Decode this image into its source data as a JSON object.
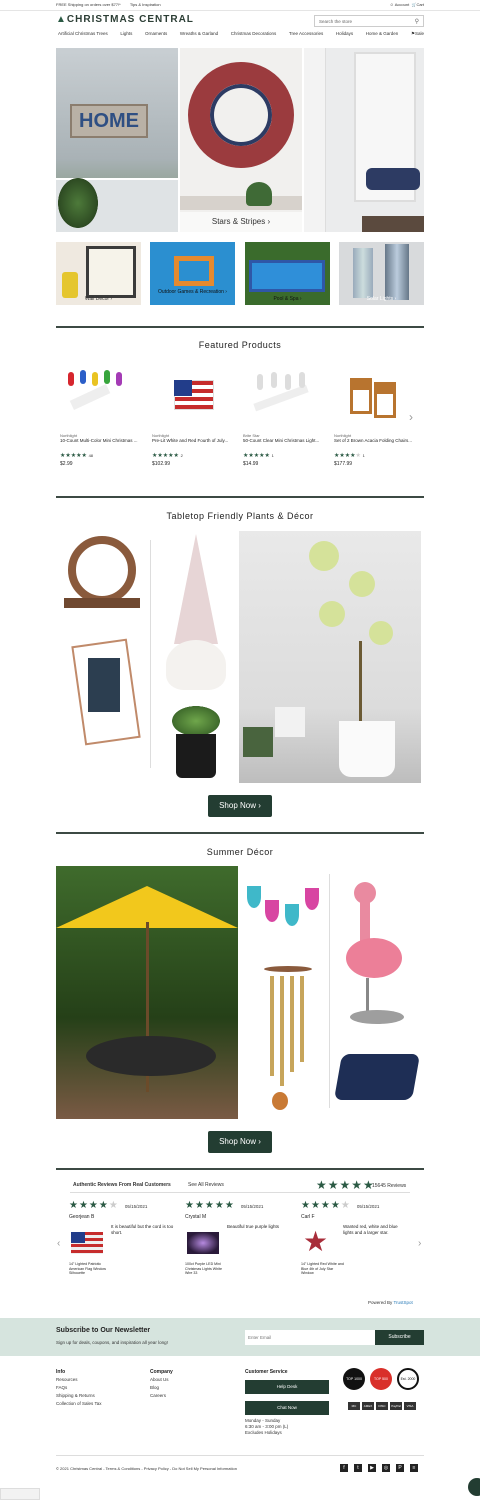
{
  "topbar": {
    "shipping": "FREE Shipping on orders over $77!*",
    "tips": "Tips & Inspiration",
    "account": "Account",
    "cart": "Cart"
  },
  "header": {
    "logo": "CHRISTMAS CENTRAL",
    "search_placeholder": "Search the store"
  },
  "nav": [
    "Artificial Christmas Trees",
    "Lights",
    "Ornaments",
    "Wreaths & Garland",
    "Christmas Decorations",
    "Tree Accessories",
    "Holidays",
    "Home & Garden",
    "Sale"
  ],
  "hero": {
    "caption": "Stars & Stripes ›"
  },
  "panels": [
    {
      "label": "Wall Decor ›"
    },
    {
      "label": "Outdoor Games & Recreation ›"
    },
    {
      "label": "Pool & Spa ›"
    },
    {
      "label": "Solar Lights ›"
    }
  ],
  "featured": {
    "title": "Featured Products",
    "products": [
      {
        "brand": "Northlight",
        "name": "10-Count Multi-Color Mini Christmas ...",
        "count": "48",
        "price": "$2.99",
        "rating": 5
      },
      {
        "brand": "Northlight",
        "name": "Pre-Lit White and Red Fourth of July...",
        "count": "2",
        "price": "$102.99",
        "rating": 5
      },
      {
        "brand": "Brite Star",
        "name": "50-Count Clear Mini Christmas Light...",
        "count": "1",
        "price": "$14.99",
        "rating": 5
      },
      {
        "brand": "Northlight",
        "name": "Set of 2 Brown Acacia Folding Chairs...",
        "count": "1",
        "price": "$177.99",
        "rating": 4
      }
    ]
  },
  "tabletop": {
    "title": "Tabletop Friendly Plants & Décor",
    "cta": "Shop Now ›"
  },
  "summer": {
    "title": "Summer Décor",
    "cta": "Shop Now ›"
  },
  "reviews": {
    "heading": "Authentic Reviews From Real Customers",
    "see_all": "See All Reviews",
    "total": "15645 Reviews",
    "powered": "Powered By",
    "brand": "TrustSpot",
    "items": [
      {
        "name": "Georjean B",
        "date": "05/15/2021",
        "text": "It is beautiful but the cord is too short.",
        "product": "14\" Lighted Patriotic American Flag Window Silhouette",
        "rating": 4
      },
      {
        "name": "Crystal M",
        "date": "05/15/2021",
        "text": "Beautiful true purple lights",
        "product": "100ct Purple LED Mini Christmas Lights White Wire 33",
        "rating": 5
      },
      {
        "name": "Carl F",
        "date": "05/15/2021",
        "text": "Wanted red, white and blue lights and a larger star.",
        "product": "14\" Lighted Red White and Blue 4th of July Star Window",
        "rating": 4
      }
    ]
  },
  "newsletter": {
    "title": "Subscribe to Our Newsletter",
    "subtitle": "Sign up for deals, coupons, and inspiration all year long!",
    "placeholder": "Enter Email",
    "button": "Subscribe"
  },
  "footer": {
    "info_title": "Info",
    "info": [
      "Resources",
      "FAQs",
      "Shipping & Returns",
      "Collection of Sales Tax"
    ],
    "company_title": "Company",
    "company": [
      "About Us",
      "Blog",
      "Careers"
    ],
    "cs_title": "Customer Service",
    "help": "Help Desk",
    "chat": "Chat Now",
    "hours1": "Monday - Sunday",
    "hours2": "6:30 am - 3:00 pm (L)",
    "hours3": "Excludes Holidays",
    "badges": [
      "TOP 1000",
      "TOP 500",
      "Est. 2000"
    ],
    "cards": [
      "MC",
      "AMEX",
      "DISC",
      "PayPal",
      "VISA"
    ],
    "copyright": "© 2021 Christmas Central - Terms & Conditions - Privacy Policy - Do Not Sell My Personal Information",
    "social": [
      "f",
      "t",
      "▶",
      "◎",
      "P",
      "≡"
    ]
  },
  "colors": {
    "accent": "#233d32",
    "star": "#2b5a44",
    "newsletter_bg": "#d6e4de"
  }
}
